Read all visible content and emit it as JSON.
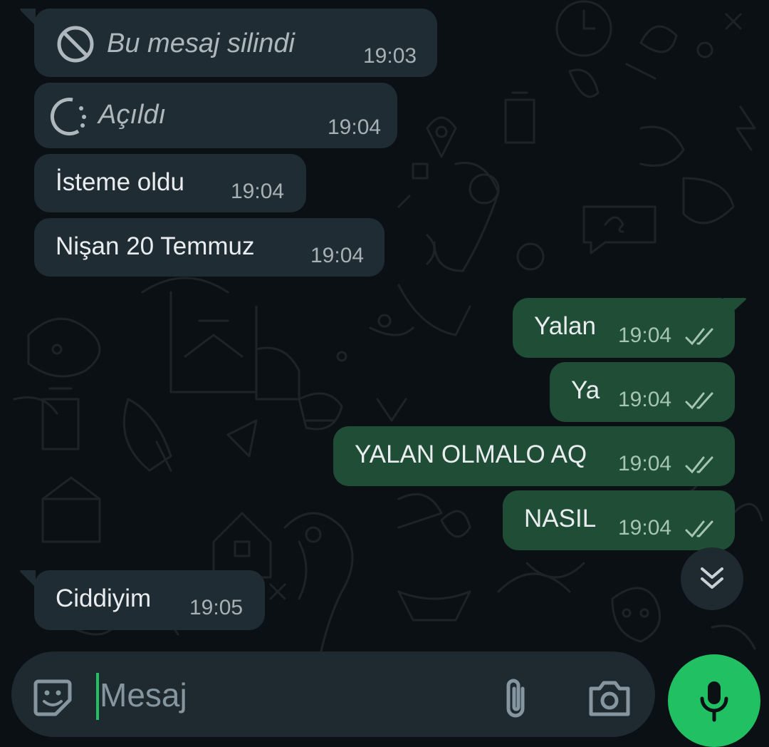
{
  "colors": {
    "incoming_bubble": "#202c33",
    "outgoing_bubble": "#1f4d35",
    "accent_green": "#21c063",
    "read_ticks": "#a6c5b1"
  },
  "messages": [
    {
      "direction": "incoming",
      "text": "Bu mesaj silindi",
      "time": "19:03",
      "kind": "deleted",
      "icon": "prohibited-icon"
    },
    {
      "direction": "incoming",
      "text": "Açıldı",
      "time": "19:04",
      "kind": "view-once-opened",
      "icon": "view-once-icon"
    },
    {
      "direction": "incoming",
      "text": "İsteme oldu",
      "time": "19:04"
    },
    {
      "direction": "incoming",
      "text": "Nişan 20 Temmuz",
      "time": "19:04"
    },
    {
      "direction": "outgoing",
      "text": "Yalan",
      "time": "19:04",
      "status": "read"
    },
    {
      "direction": "outgoing",
      "text": "Ya",
      "time": "19:04",
      "status": "read"
    },
    {
      "direction": "outgoing",
      "text": "YALAN OLMALO AQ",
      "time": "19:04",
      "status": "read"
    },
    {
      "direction": "outgoing",
      "text": "NASIL",
      "time": "19:04",
      "status": "read"
    },
    {
      "direction": "incoming",
      "text": "Ciddiyim",
      "time": "19:05"
    }
  ],
  "composer": {
    "placeholder": "Mesaj",
    "emoji_icon": "sticker-icon",
    "attach_icon": "paperclip-icon",
    "camera_icon": "camera-icon",
    "send_icon": "microphone-icon"
  },
  "scroll_button_icon": "double-chevron-down-icon"
}
